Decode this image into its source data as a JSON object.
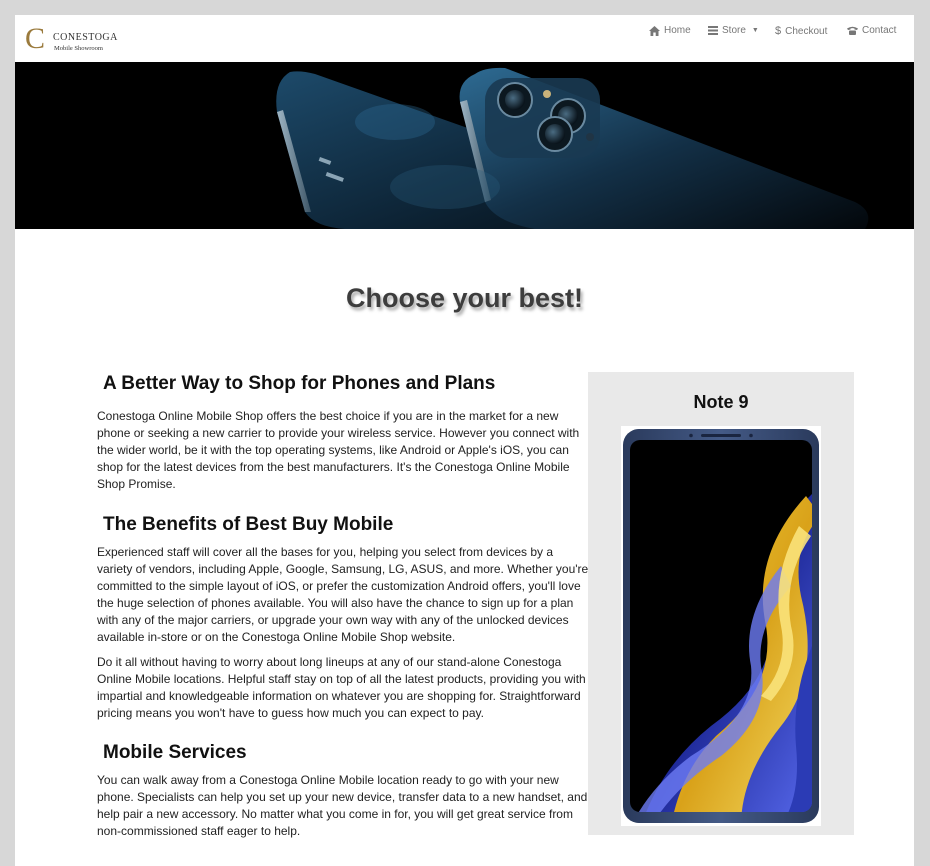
{
  "brand": {
    "name": "CONESTOGA",
    "tagline": "Mobile Showroom",
    "mark": "C"
  },
  "nav": {
    "home": "Home",
    "store": "Store",
    "checkout": "Checkout",
    "contact": "Contact"
  },
  "icons": {
    "home": "home-icon",
    "store": "list-icon",
    "checkout": "dollar-icon",
    "contact": "phone-icon",
    "store_caret": "caret-down-icon"
  },
  "main": {
    "title": "Choose your best!"
  },
  "sections": [
    {
      "title": "A Better Way to Shop for Phones and Plans",
      "paragraphs": [
        "Conestoga Online Mobile Shop offers the best choice if you are in the market for a new phone or seeking a new carrier to provide your wireless service. However you connect with the wider world, be it with the top operating systems, like Android or Apple's iOS, you can shop for the latest devices from the best manufacturers. It's the Conestoga Online Mobile Shop Promise."
      ]
    },
    {
      "title": "The Benefits of Best Buy Mobile",
      "paragraphs": [
        "Experienced staff will cover all the bases for you, helping you select from devices by a variety of vendors, including Apple, Google, Samsung, LG, ASUS, and more. Whether you're committed to the simple layout of iOS, or prefer the customization Android offers, you'll love the huge selection of phones available. You will also have the chance to sign up for a plan with any of the major carriers, or upgrade your own way with any of the unlocked devices available in-store or on the Conestoga Online Mobile Shop website.",
        "Do it all without having to worry about long lineups at any of our stand-alone Conestoga Online Mobile locations. Helpful staff stay on top of all the latest products, providing you with impartial and knowledgeable information on whatever you are shopping for. Straightforward pricing means you won't have to guess how much you can expect to pay."
      ]
    },
    {
      "title": "Mobile Services",
      "paragraphs": [
        "You can walk away from a Conestoga Online Mobile location ready to go with your new phone. Specialists can help you set up your new device, transfer data to a new handset, and help pair a new accessory. No matter what you come in for, you will get great service from non-commissioned staff eager to help."
      ]
    }
  ],
  "featured": {
    "product_name": "Note 9"
  },
  "colors": {
    "page_bg": "#d7d7d7",
    "brand_gold": "#9a7a3c",
    "nav_text": "#777777",
    "card_bg": "#e9e9e9"
  }
}
